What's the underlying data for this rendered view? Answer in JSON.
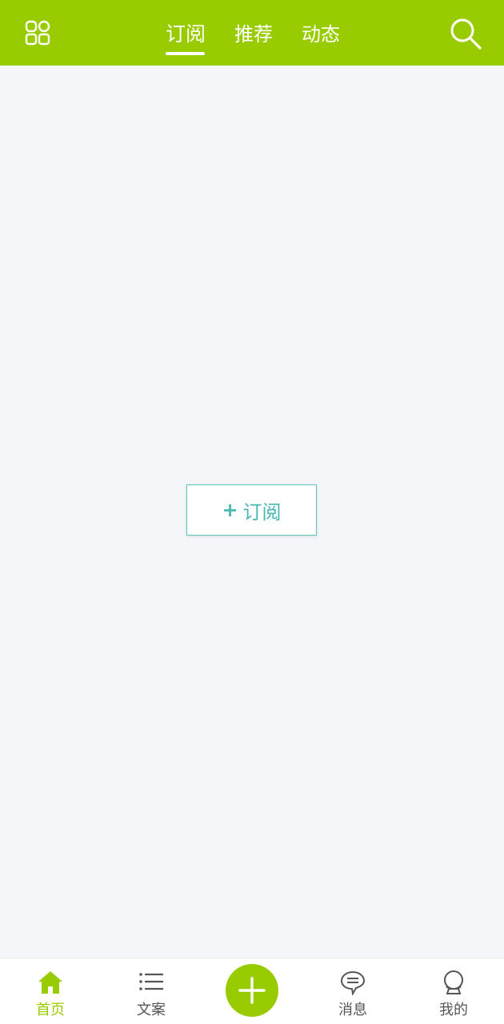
{
  "header": {
    "grid_icon": "grid-icon",
    "search_icon": "search-icon",
    "tabs": [
      {
        "label": "订阅",
        "active": true
      },
      {
        "label": "推荐",
        "active": false
      },
      {
        "label": "动态",
        "active": false
      }
    ]
  },
  "main": {
    "subscribe_button": {
      "plus": "+",
      "label": "订阅"
    }
  },
  "bottom_nav": {
    "items": [
      {
        "label": "首页",
        "icon": "home-icon",
        "active": true
      },
      {
        "label": "文案",
        "icon": "list-icon",
        "active": false
      },
      {
        "label": "消息",
        "icon": "message-icon",
        "active": false
      },
      {
        "label": "我的",
        "icon": "user-icon",
        "active": false
      }
    ],
    "center_button_icon": "plus-icon"
  },
  "colors": {
    "brand": "#99cc00",
    "accent": "#4ab8b2",
    "background": "#f5f6fa"
  }
}
